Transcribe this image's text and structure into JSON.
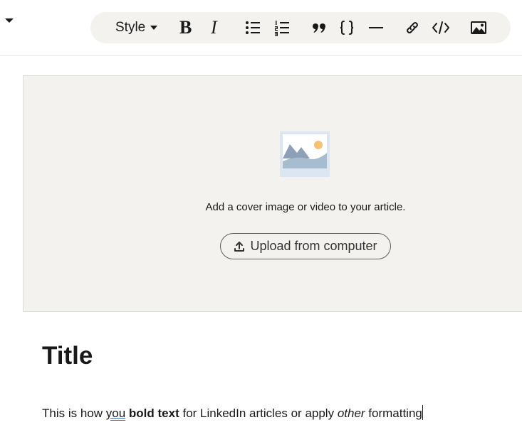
{
  "toolbar": {
    "style_label": "Style",
    "bold_label": "B",
    "italic_label": "I",
    "buttons": [
      "style",
      "bold",
      "italic",
      "bulleted-list",
      "numbered-list",
      "quote",
      "code-block",
      "divider",
      "link",
      "embed-code",
      "image"
    ]
  },
  "cover": {
    "prompt": "Add a cover image or video to your article.",
    "upload_label": "Upload from computer"
  },
  "article": {
    "title": "Title",
    "body": {
      "part1": "This is how ",
      "misspelled_word": "you",
      "part2": " ",
      "bold_text": "bold text",
      "part3": " for LinkedIn articles or apply ",
      "italic_text": "other",
      "part4": " formatting"
    }
  },
  "colors": {
    "toolbar_bg": "#f3f2ef",
    "cover_bg": "#f3f2ef",
    "text": "#191919",
    "spellcheck_underline": "#4a6fb3"
  }
}
